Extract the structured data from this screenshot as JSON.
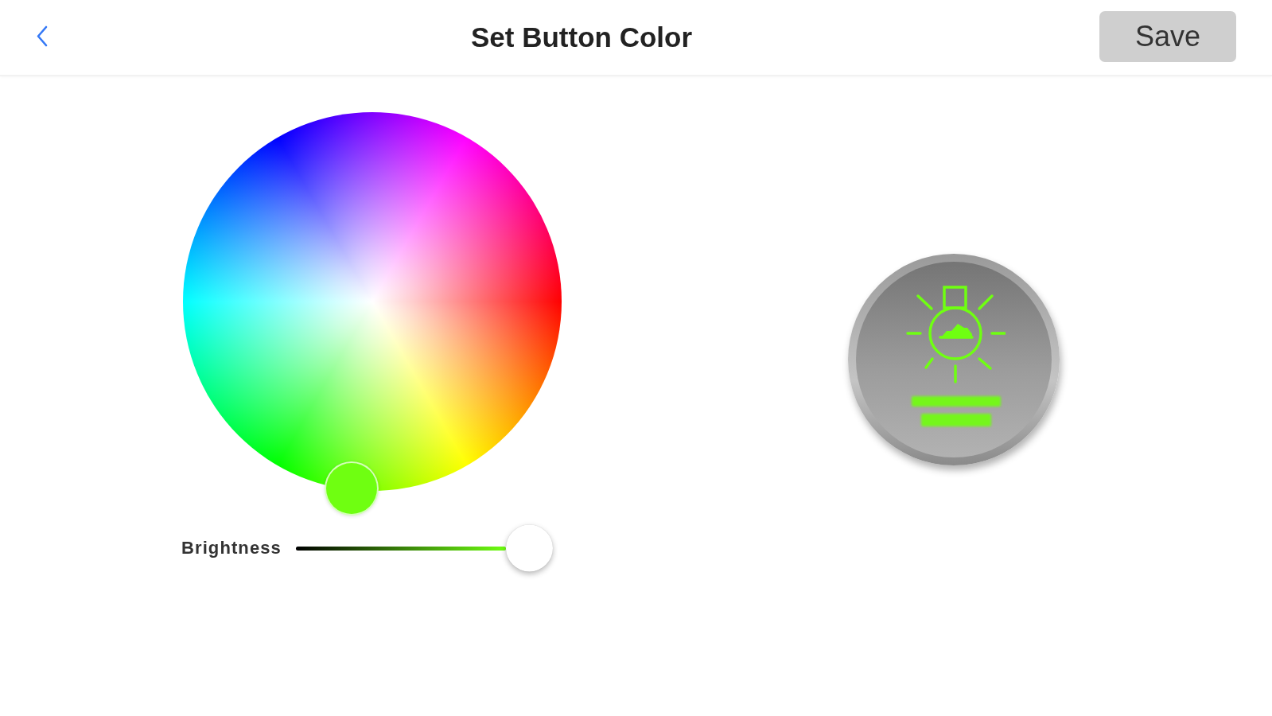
{
  "header": {
    "title": "Set Button Color",
    "save_button": "Save"
  },
  "color_wheel": {
    "color": "#6fff11"
  },
  "brightness": {
    "label": "Brightness",
    "level": 1
  }
}
